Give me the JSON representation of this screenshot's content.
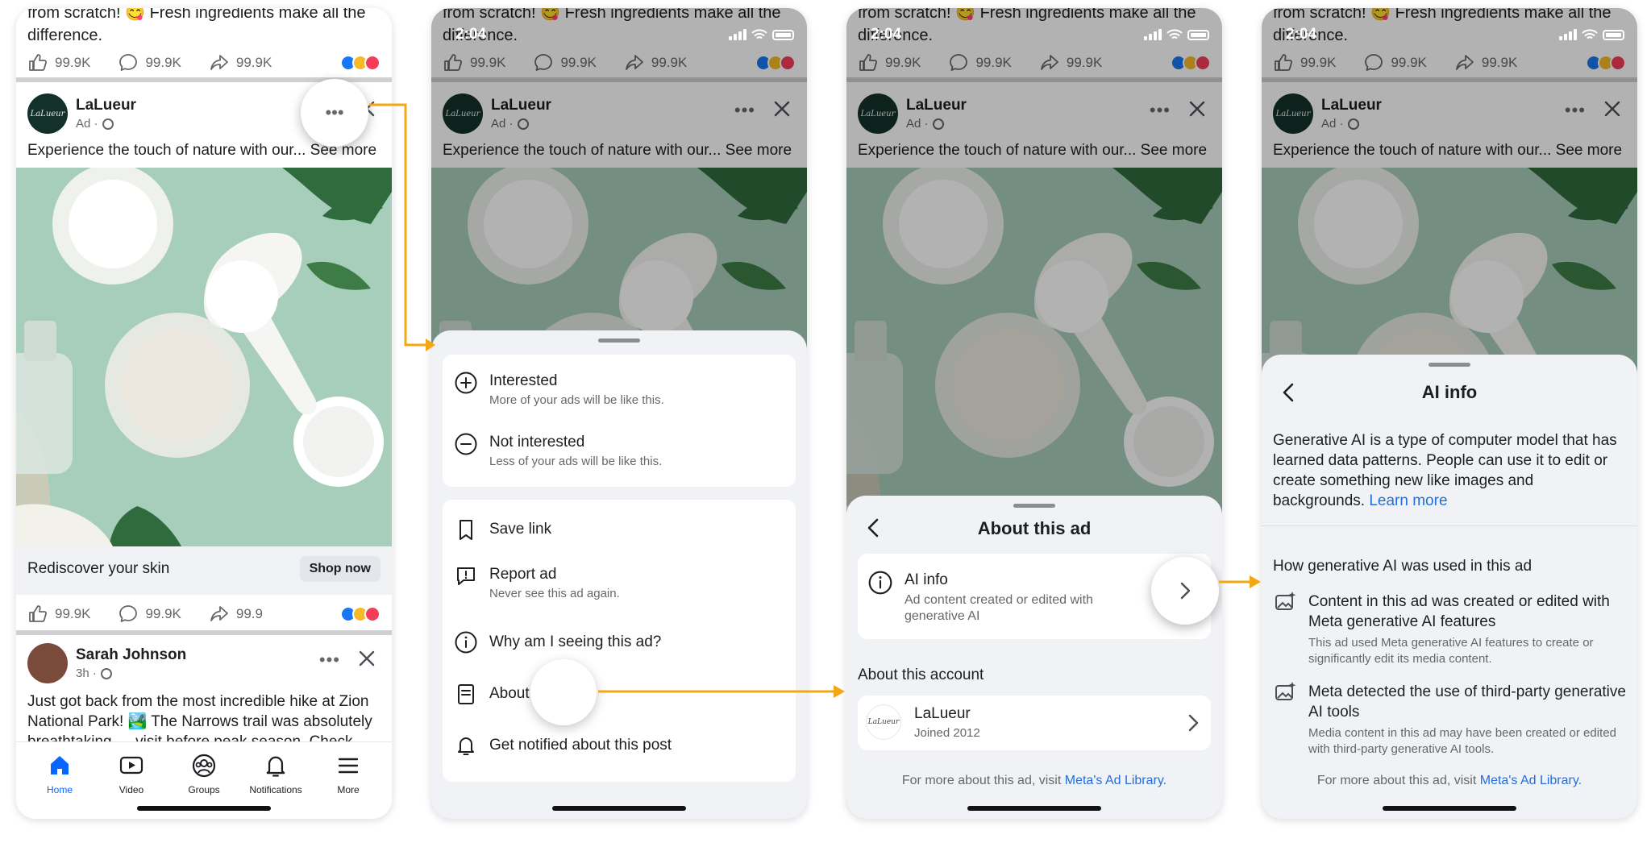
{
  "colors": {
    "accent": "#f3a712",
    "link": "#216fdb",
    "fb_blue": "#0866ff"
  },
  "status_time": "2:04",
  "prev_post_text_line1": "from scratch! 😋 Fresh ingredients make all the",
  "prev_post_text_line2": "difference.",
  "stats": {
    "likes": "99.9K",
    "comments": "99.9K",
    "shares": "99.9K",
    "shares_short": "99.9"
  },
  "ad": {
    "brand": "LaLueur",
    "avatar_text": "LaLueur",
    "meta": "Ad ·",
    "caption": "Experience the touch of nature with our...",
    "see_more": "See more",
    "cta_text": "Rediscover your skin",
    "cta_button": "Shop now"
  },
  "post2": {
    "author": "Sarah Johnson",
    "meta": "3h ·",
    "text": "Just got back from the most incredible hike at Zion National Park! 🏞️ The Narrows trail was absolutely breathtaking — visit before peak season. Check"
  },
  "tabs": [
    {
      "label": "Home",
      "icon": "home-icon"
    },
    {
      "label": "Video",
      "icon": "video-icon"
    },
    {
      "label": "Groups",
      "icon": "groups-icon"
    },
    {
      "label": "Notifications",
      "icon": "bell-icon"
    },
    {
      "label": "More",
      "icon": "menu-icon"
    }
  ],
  "menu": {
    "interested": {
      "label": "Interested",
      "sub": "More of your ads will be like this."
    },
    "not_interested": {
      "label": "Not interested",
      "sub": "Less of your ads will be like this."
    },
    "save_link": "Save link",
    "report": {
      "label": "Report ad",
      "sub": "Never see this ad again."
    },
    "why": "Why am I seeing this ad?",
    "about": "About this ad",
    "notify": "Get notified about this post"
  },
  "about_sheet": {
    "title": "About this ad",
    "ai_info_label": "AI info",
    "ai_info_sub": "Ad content created or edited with generative AI",
    "section_account": "About this account",
    "account_name": "LaLueur",
    "account_joined": "Joined 2012",
    "footer_text": "For more about this ad, visit",
    "footer_link": "Meta's Ad Library."
  },
  "ai_sheet": {
    "title": "AI info",
    "body": "Generative AI is a type of computer model that has learned data patterns. People can use it to edit or create something new like images and backgrounds.",
    "learn_more": "Learn more",
    "section": "How generative AI was used in this ad",
    "item1_label": "Content in this ad was created or edited with Meta generative AI features",
    "item1_sub": "This ad used Meta generative AI features to create or significantly edit its media content.",
    "item2_label": "Meta detected the use of third-party generative AI tools",
    "item2_sub": "Media content in this ad may have been created or edited with third-party generative AI tools.",
    "footer_text": "For more about this ad, visit",
    "footer_link": "Meta's Ad Library."
  }
}
